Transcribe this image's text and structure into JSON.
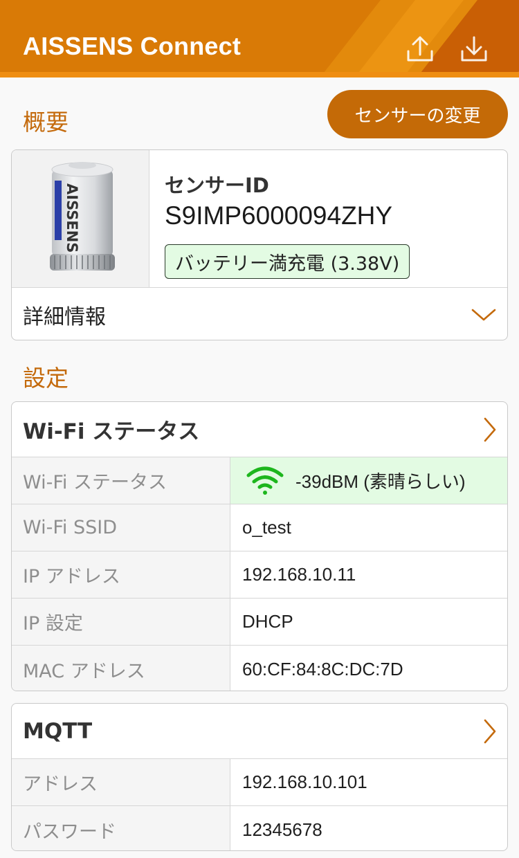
{
  "header": {
    "title": "AISSENS Connect",
    "upload_icon": "upload-icon",
    "download_icon": "download-icon",
    "accent": "#d97a06"
  },
  "overview": {
    "title": "概要",
    "change_button": "センサーの変更",
    "sensor": {
      "image_label": "AISSENS",
      "id_label": "センサーID",
      "id_value": "S9IMP6000094ZHY",
      "battery": "バッテリー満充電 (3.38V)"
    },
    "details_label": "詳細情報"
  },
  "settings": {
    "title": "設定",
    "wifi": {
      "title": "Wi-Fi ステータス",
      "rows": [
        {
          "key": "Wi-Fi ステータス",
          "value": "-39dBM (素晴らしい)"
        },
        {
          "key": "Wi-Fi SSID",
          "value": "o_test"
        },
        {
          "key": "IP アドレス",
          "value": "192.168.10.11"
        },
        {
          "key": "IP 設定",
          "value": "DHCP"
        },
        {
          "key": "MAC アドレス",
          "value": "60:CF:84:8C:DC:7D"
        }
      ]
    },
    "mqtt": {
      "title": "MQTT",
      "rows": [
        {
          "key": "アドレス",
          "value": "192.168.10.101"
        },
        {
          "key": "パスワード",
          "value": "12345678"
        }
      ]
    }
  },
  "colors": {
    "section_title": "#c46a0c",
    "good_status_bg": "#e3fbe3",
    "wifi_green": "#1db61d"
  }
}
